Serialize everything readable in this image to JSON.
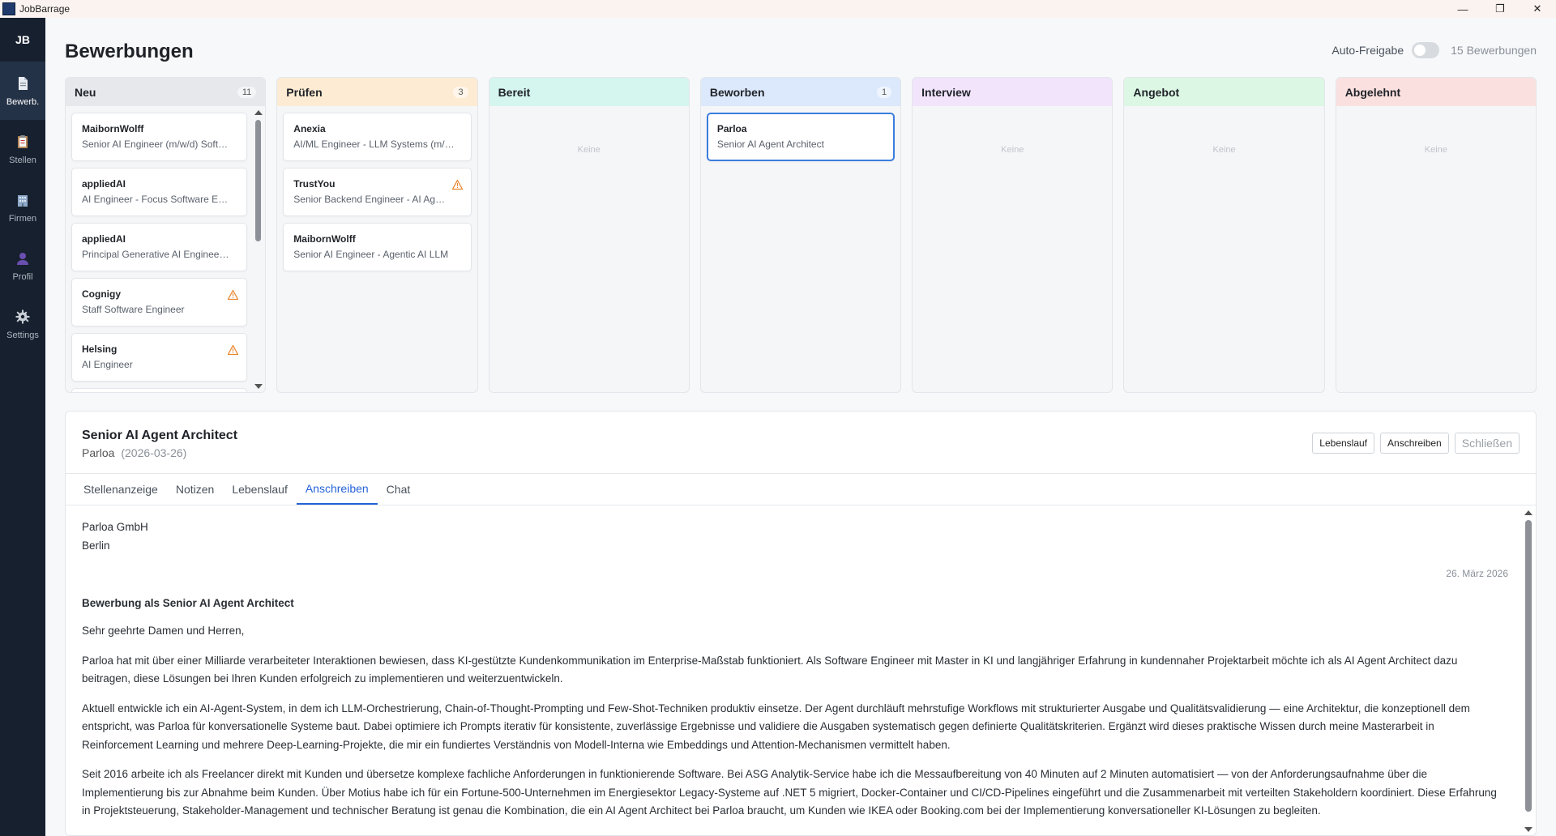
{
  "window": {
    "title": "JobBarrage",
    "minimize": "—",
    "maximize": "❐",
    "close": "✕"
  },
  "sidebar": {
    "logo": "JB",
    "items": [
      {
        "label": "Bewerb.",
        "icon": "document-icon",
        "active": true
      },
      {
        "label": "Stellen",
        "icon": "clipboard-icon",
        "active": false
      },
      {
        "label": "Firmen",
        "icon": "building-icon",
        "active": false
      },
      {
        "label": "Profil",
        "icon": "user-icon",
        "active": false
      },
      {
        "label": "Settings",
        "icon": "gear-icon",
        "active": false
      }
    ]
  },
  "header": {
    "title": "Bewerbungen",
    "auto_label": "Auto-Freigabe",
    "auto_enabled": false,
    "count_label": "15 Bewerbungen"
  },
  "columns": [
    {
      "title": "Neu",
      "count": "11",
      "color": "#e6e8ec",
      "cards": [
        {
          "company": "MaibornWolff",
          "role": "Senior AI Engineer (m/w/d) Software Engineering",
          "warn": false
        },
        {
          "company": "appliedAI",
          "role": "AI Engineer - Focus Software Engineering",
          "warn": false
        },
        {
          "company": "appliedAI",
          "role": "Principal Generative AI Engineer - Agents",
          "warn": false
        },
        {
          "company": "Cognigy",
          "role": "Staff Software Engineer",
          "warn": true
        },
        {
          "company": "Helsing",
          "role": "AI Engineer",
          "warn": true
        }
      ]
    },
    {
      "title": "Prüfen",
      "count": "3",
      "color": "#fdebd3",
      "cards": [
        {
          "company": "Anexia",
          "role": "AI/ML Engineer - LLM Systems (m/w/d)",
          "warn": false
        },
        {
          "company": "TrustYou",
          "role": "Senior Backend Engineer - AI Agents",
          "warn": true
        },
        {
          "company": "MaibornWolff",
          "role": "Senior AI Engineer - Agentic AI LLM",
          "warn": false
        }
      ]
    },
    {
      "title": "Bereit",
      "count": "",
      "color": "#d5f5ef",
      "cards": [],
      "empty": "Keine"
    },
    {
      "title": "Beworben",
      "count": "1",
      "color": "#dce8fb",
      "cards": [
        {
          "company": "Parloa",
          "role": "Senior AI Agent Architect",
          "warn": false,
          "selected": true
        }
      ]
    },
    {
      "title": "Interview",
      "count": "",
      "color": "#f1e4fb",
      "cards": [],
      "empty": "Keine"
    },
    {
      "title": "Angebot",
      "count": "",
      "color": "#dcf7e4",
      "cards": [],
      "empty": "Keine"
    },
    {
      "title": "Abgelehnt",
      "count": "",
      "color": "#fbe0e0",
      "cards": [],
      "empty": "Keine"
    }
  ],
  "detail": {
    "title": "Senior AI Agent Architect",
    "company": "Parloa",
    "date": "(2026-03-26)",
    "buttons": {
      "cv": "Lebenslauf",
      "letter": "Anschreiben",
      "close": "Schließen"
    },
    "tabs": [
      "Stellenanzeige",
      "Notizen",
      "Lebenslauf",
      "Anschreiben",
      "Chat"
    ],
    "active_tab": "Anschreiben",
    "letter": {
      "addr1": "Parloa GmbH",
      "addr2": "Berlin",
      "date": "26. März 2026",
      "subject": "Bewerbung als Senior AI Agent Architect",
      "greeting": "Sehr geehrte Damen und Herren,",
      "p1": "Parloa hat mit über einer Milliarde verarbeiteter Interaktionen bewiesen, dass KI-gestützte Kundenkommunikation im Enterprise-Maßstab funktioniert. Als Software Engineer mit Master in KI und langjähriger Erfahrung in kundennaher Projektarbeit möchte ich als AI Agent Architect dazu beitragen, diese Lösungen bei Ihren Kunden erfolgreich zu implementieren und weiterzuentwickeln.",
      "p2": "Aktuell entwickle ich ein AI-Agent-System, in dem ich LLM-Orchestrierung, Chain-of-Thought-Prompting und Few-Shot-Techniken produktiv einsetze. Der Agent durchläuft mehrstufige Workflows mit strukturierter Ausgabe und Qualitätsvalidierung — eine Architektur, die konzeptionell dem entspricht, was Parloa für konversationelle Systeme baut. Dabei optimiere ich Prompts iterativ für konsistente, zuverlässige Ergebnisse und validiere die Ausgaben systematisch gegen definierte Qualitätskriterien. Ergänzt wird dieses praktische Wissen durch meine Masterarbeit in Reinforcement Learning und mehrere Deep-Learning-Projekte, die mir ein fundiertes Verständnis von Modell-Interna wie Embeddings und Attention-Mechanismen vermittelt haben.",
      "p3": "Seit 2016 arbeite ich als Freelancer direkt mit Kunden und übersetze komplexe fachliche Anforderungen in funktionierende Software. Bei ASG Analytik-Service habe ich die Messaufbereitung von 40 Minuten auf 2 Minuten automatisiert — von der Anforderungsaufnahme über die Implementierung bis zur Abnahme beim Kunden. Über Motius habe ich für ein Fortune-500-Unternehmen im Energiesektor Legacy-Systeme auf .NET 5 migriert, Docker-Container und CI/CD-Pipelines eingeführt und die Zusammenarbeit mit verteilten Stakeholdern koordiniert. Diese Erfahrung in Projektsteuerung, Stakeholder-Management und technischer Beratung ist genau die Kombination, die ein AI Agent Architect bei Parloa braucht, um Kunden wie IKEA oder Booking.com bei der Implementierung konversationeller KI-Lösungen zu begleiten."
    }
  }
}
